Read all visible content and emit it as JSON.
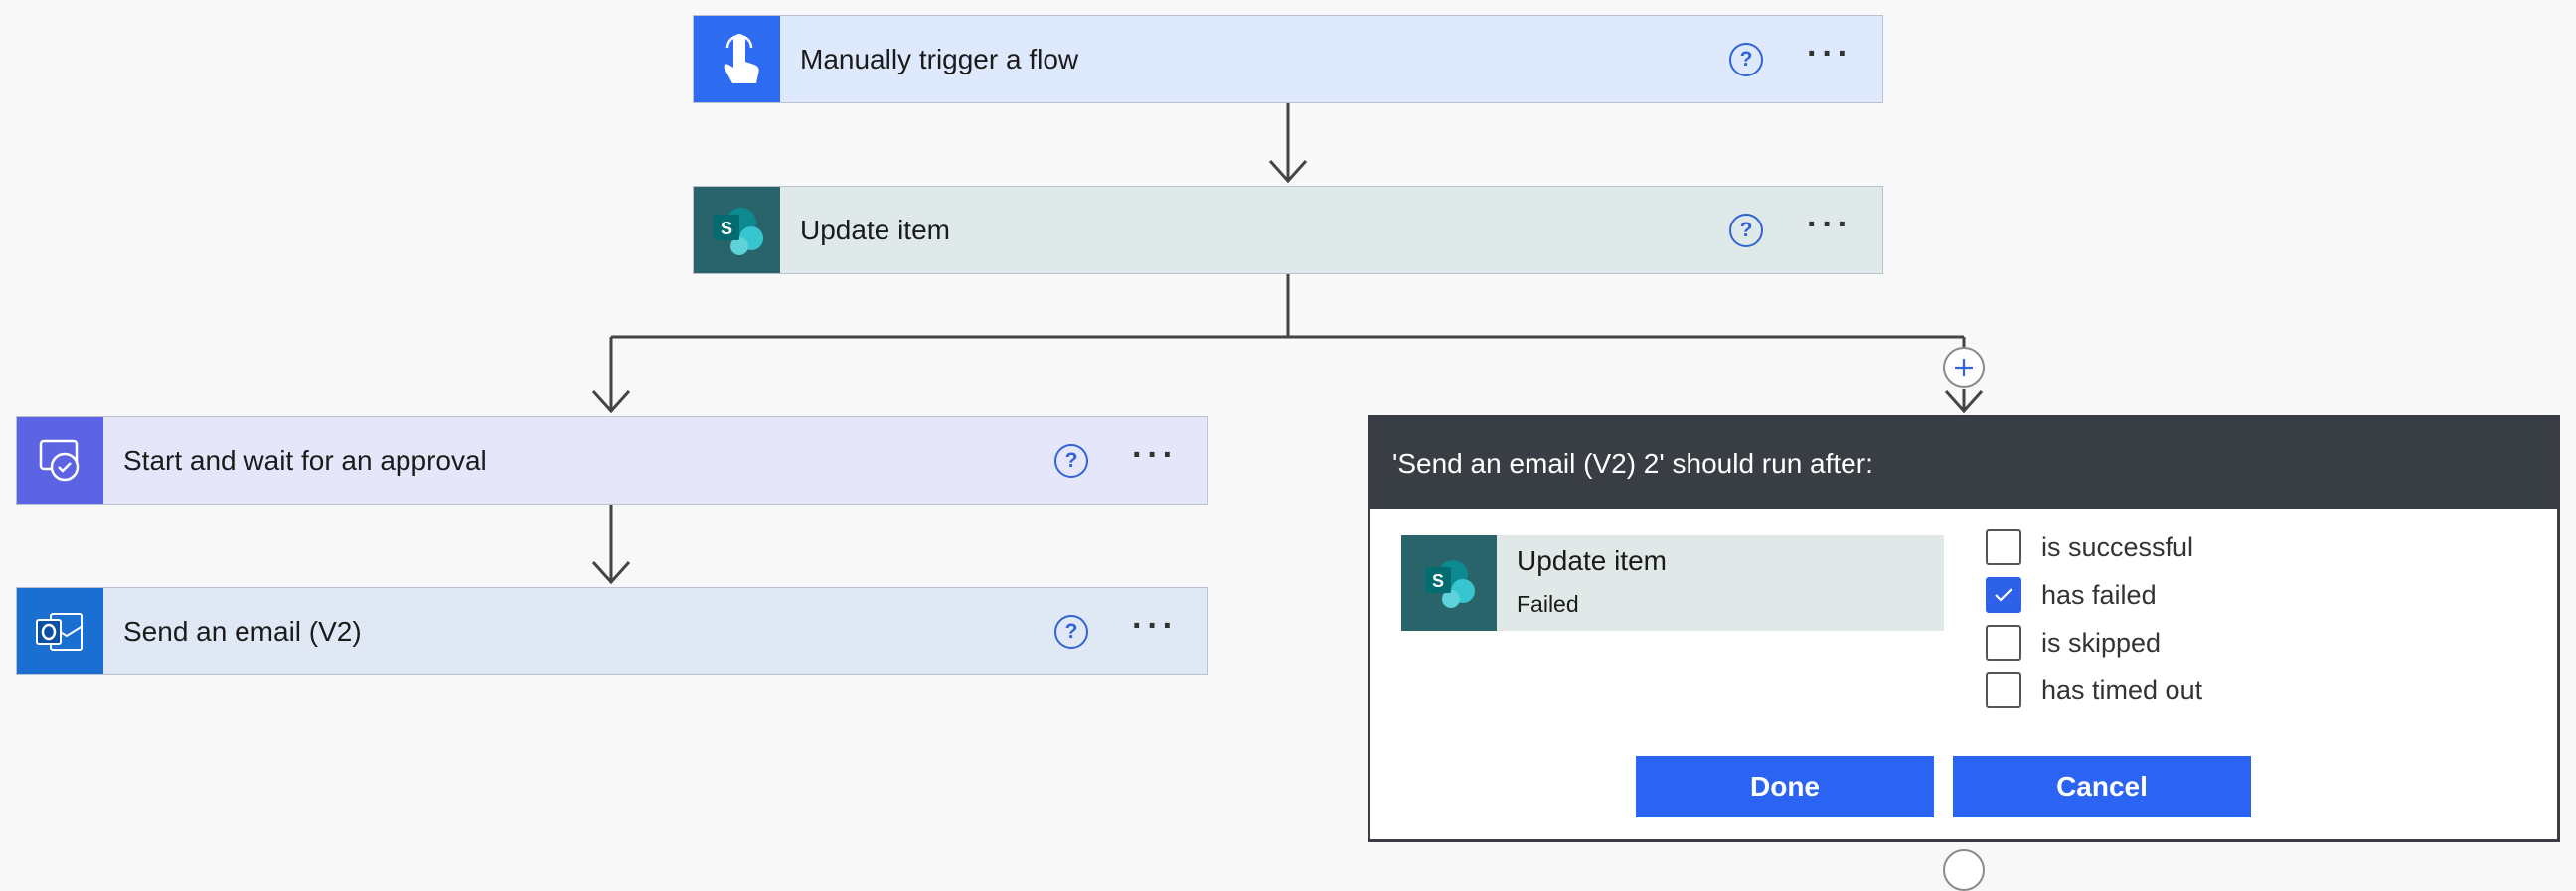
{
  "flow": {
    "trigger": {
      "title": "Manually trigger a flow",
      "icon": "touch-icon",
      "help": "?",
      "more": "···"
    },
    "update_item": {
      "title": "Update item",
      "icon": "sharepoint-icon",
      "help": "?",
      "more": "···"
    },
    "approval": {
      "title": "Start and wait for an approval",
      "icon": "approval-icon",
      "help": "?",
      "more": "···"
    },
    "send_email": {
      "title": "Send an email (V2)",
      "icon": "outlook-icon",
      "help": "?",
      "more": "···"
    }
  },
  "dialog": {
    "header": "'Send an email (V2) 2' should run after:",
    "source": {
      "title": "Update item",
      "status": "Failed",
      "icon": "sharepoint-icon"
    },
    "options": [
      {
        "label": "is successful",
        "checked": false
      },
      {
        "label": "has failed",
        "checked": true
      },
      {
        "label": "is skipped",
        "checked": false
      },
      {
        "label": "has timed out",
        "checked": false
      }
    ],
    "done_label": "Done",
    "cancel_label": "Cancel"
  },
  "colors": {
    "accent": "#2b64f2",
    "dialog_header": "#393e44",
    "sharepoint": "#28646a",
    "trigger": "#2d6cf0",
    "approval": "#5d64e4",
    "outlook": "#1a6fd1"
  }
}
